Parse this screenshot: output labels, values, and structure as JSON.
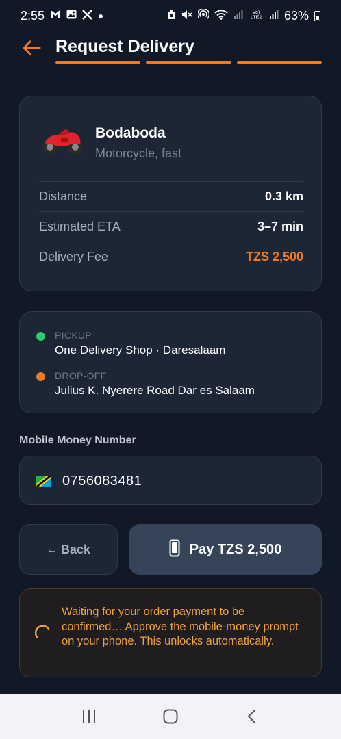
{
  "status_bar": {
    "time": "2:55",
    "left_icons": [
      "gmail-icon",
      "gallery-icon",
      "x-icon",
      "dot-icon"
    ],
    "right_icons": [
      "alarm-icon",
      "mute-icon",
      "hotspot-icon",
      "wifi-icon",
      "signal-icon",
      "volte-icon",
      "signal-icon"
    ],
    "volte_label": "Vo)\nLTE2",
    "battery": "63%"
  },
  "header": {
    "title": "Request Delivery",
    "steps_total": 3,
    "steps_completed": 3
  },
  "vehicle": {
    "name": "Bodaboda",
    "description": "Motorcycle, fast",
    "icon": "motorcycle-icon",
    "rows": [
      {
        "label": "Distance",
        "value": "0.3 km",
        "accent": false
      },
      {
        "label": "Estimated ETA",
        "value": "3–7 min",
        "accent": false
      },
      {
        "label": "Delivery Fee",
        "value": "TZS 2,500",
        "accent": true
      }
    ]
  },
  "route": {
    "pickup_label": "PICKUP",
    "pickup_value": "One Delivery Shop · Daresalaam",
    "dropoff_label": "DROP-OFF",
    "dropoff_value": "Julius K. Nyerere Road Dar es Salaam"
  },
  "payment": {
    "field_label": "Mobile Money Number",
    "phone_value": "0756083481",
    "flag_icon": "tanzania-flag-icon",
    "back_label": "Back",
    "back_arrow": "←",
    "pay_label": "Pay TZS 2,500"
  },
  "waiting": {
    "message": "Waiting for your order payment to be confirmed… Approve the mobile-money prompt on your phone. This unlocks automatically."
  },
  "colors": {
    "background": "#111926",
    "card": "#1c2634",
    "accent": "#f07a26",
    "pickup_dot": "#2ecc71",
    "dropoff_dot": "#f07a26",
    "warning_text": "#f0a23a"
  }
}
